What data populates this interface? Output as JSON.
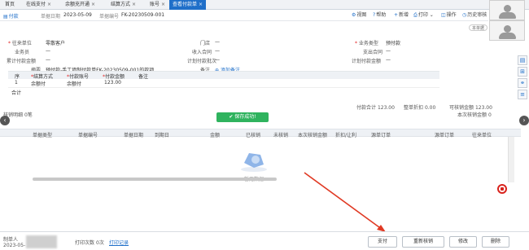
{
  "tabs": [
    {
      "label": "首页",
      "close": ""
    },
    {
      "label": "在线支付",
      "close": "×"
    },
    {
      "label": "余额充开通",
      "close": "×"
    },
    {
      "label": "结算方式",
      "close": "×"
    },
    {
      "label": "账号",
      "close": "×"
    },
    {
      "label": "查看付款单",
      "close": "×"
    }
  ],
  "toolbar": {
    "doc_title": "付款",
    "date_label": "单据日期",
    "date_value": "2023-05-09",
    "no_label": "单据编号",
    "no_value": "FK-20230509-001",
    "settings": "视图",
    "help": "帮助",
    "add": "新增",
    "print": "打印",
    "operate": "操作",
    "history": "历史审核",
    "pill": "本单据"
  },
  "form": {
    "unit_label": "往来单位",
    "unit_value": "零散客户",
    "clerk_label": "业务员",
    "clerk_value": "—",
    "acc_label": "累计付款金额",
    "acc_value": "—",
    "summary_label": "摘要",
    "summary_value": "预付款-手工填制付款单FK-20230509-001的款项",
    "dept_label": "门店",
    "dept_value": "—",
    "revenue_label": "收入合同",
    "revenue_value": "—",
    "plan_label": "计划付款批次",
    "plan_value": "—",
    "remark_label": "备注",
    "remark_link": "添加备注",
    "type_label": "业务类型",
    "type_value": "预付款",
    "paycon_label": "支出合同",
    "paycon_value": "—",
    "planamt_label": "计划付款金额",
    "planamt_value": "—"
  },
  "grid1": {
    "headers": [
      "序",
      "结算方式",
      "付款账号",
      "付款金额",
      "备注"
    ],
    "rows": [
      [
        "1",
        "余额付",
        "余额付",
        "123.00",
        ""
      ]
    ],
    "foot": "合计"
  },
  "totals": {
    "pay_label": "付款合计",
    "pay_value": "123.00",
    "disc_label": "整单折扣",
    "disc_value": "0.00",
    "write_label": "可核销金额",
    "write_value": "123.00"
  },
  "grid2": {
    "title_left": "核销明细",
    "title_left_sub": "0笔",
    "title_right": "本次核销金额",
    "title_right_value": "0",
    "headers": [
      "单据类型",
      "单据编号",
      "单据日期",
      "到期日",
      "金额",
      "已核销",
      "未核销",
      "本次核销金额",
      "折扣/让利",
      "源单订单",
      "源单订单",
      "往来单位"
    ],
    "empty_text": "暂无数据"
  },
  "toast": "保存成功!",
  "footer": {
    "maker_label": "制单人",
    "maker_date": "2023-05-",
    "print_label": "打印次数",
    "print_value": "0次",
    "print_link": "打印记录",
    "buttons": [
      "支付",
      "重新核销",
      "修改",
      "删除"
    ]
  },
  "colors": {
    "brand": "#1f6fc9",
    "toast": "#2fb35e",
    "annotation": "#e03a24"
  }
}
